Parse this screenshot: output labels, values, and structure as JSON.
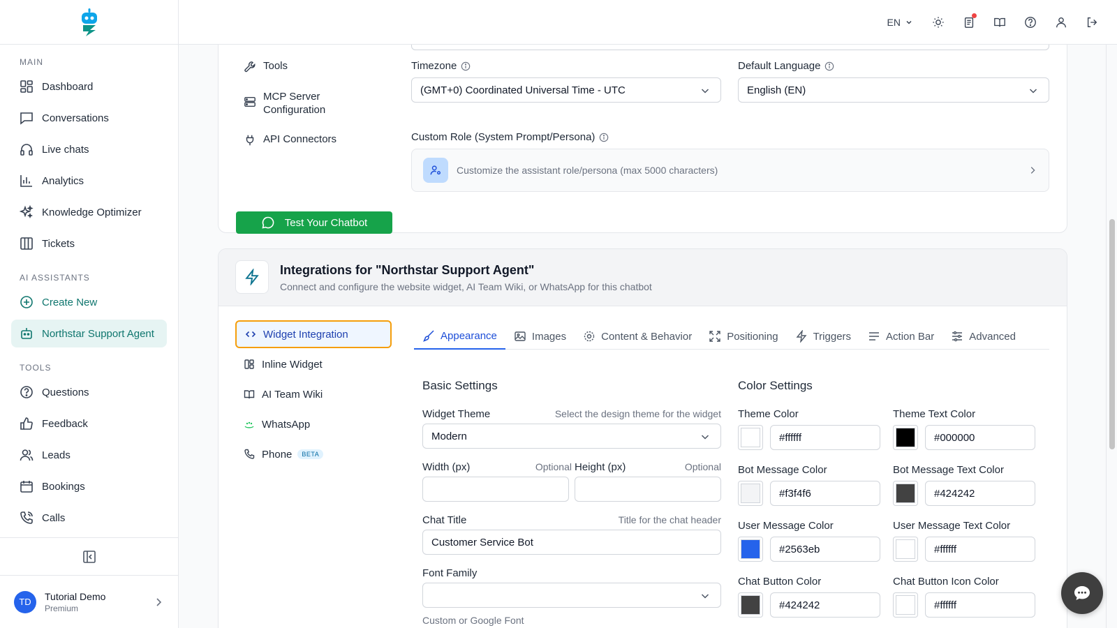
{
  "sidebar": {
    "section_main": "MAIN",
    "main_items": [
      {
        "label": "Dashboard"
      },
      {
        "label": "Conversations"
      },
      {
        "label": "Live chats"
      },
      {
        "label": "Analytics"
      },
      {
        "label": "Knowledge Optimizer"
      },
      {
        "label": "Tickets"
      }
    ],
    "section_ai": "AI ASSISTANTS",
    "create_new": "Create New",
    "active_agent": "Northstar Support Agent",
    "section_tools": "TOOLS",
    "tool_items": [
      {
        "label": "Questions"
      },
      {
        "label": "Feedback"
      },
      {
        "label": "Leads"
      },
      {
        "label": "Bookings"
      },
      {
        "label": "Calls"
      }
    ],
    "user": {
      "initials": "TD",
      "name": "Tutorial Demo",
      "plan": "Premium"
    }
  },
  "topbar": {
    "language": "EN"
  },
  "settings": {
    "menu": {
      "tools": "Tools",
      "mcp": "MCP Server Configuration",
      "api": "API Connectors",
      "test_button": "Test Your Chatbot"
    },
    "timezone_label": "Timezone",
    "timezone_value": "(GMT+0) Coordinated Universal Time - UTC",
    "language_label": "Default Language",
    "language_value": "English (EN)",
    "role_label": "Custom Role (System Prompt/Persona)",
    "role_placeholder": "Customize the assistant role/persona (max 5000 characters)"
  },
  "integrations": {
    "title": "Integrations for \"Northstar Support Agent\"",
    "subtitle": "Connect and configure the website widget, AI Team Wiki, or WhatsApp for this chatbot",
    "menu": {
      "widget": "Widget Integration",
      "inline": "Inline Widget",
      "wiki": "AI Team Wiki",
      "whatsapp": "WhatsApp",
      "phone": "Phone",
      "beta": "BETA"
    },
    "tabs": {
      "appearance": "Appearance",
      "images": "Images",
      "content": "Content & Behavior",
      "positioning": "Positioning",
      "triggers": "Triggers",
      "action_bar": "Action Bar",
      "advanced": "Advanced"
    },
    "basic": {
      "title": "Basic Settings",
      "theme_label": "Widget Theme",
      "theme_hint": "Select the design theme for the widget",
      "theme_value": "Modern",
      "width_label": "Width (px)",
      "width_hint": "Optional",
      "height_label": "Height (px)",
      "height_hint": "Optional",
      "chat_title_label": "Chat Title",
      "chat_title_hint": "Title for the chat header",
      "chat_title_value": "Customer Service Bot",
      "font_label": "Font Family",
      "font_hint": "Custom or Google Font"
    },
    "colors": {
      "title": "Color Settings",
      "theme_color_label": "Theme Color",
      "theme_color": "#ffffff",
      "theme_text_label": "Theme Text Color",
      "theme_text": "#000000",
      "bot_msg_label": "Bot Message Color",
      "bot_msg": "#f3f4f6",
      "bot_text_label": "Bot Message Text Color",
      "bot_text": "#424242",
      "user_msg_label": "User Message Color",
      "user_msg": "#2563eb",
      "user_text_label": "User Message Text Color",
      "user_text": "#ffffff",
      "chat_btn_label": "Chat Button Color",
      "chat_btn": "#424242",
      "chat_icon_label": "Chat Button Icon Color",
      "chat_icon": "#ffffff"
    }
  }
}
